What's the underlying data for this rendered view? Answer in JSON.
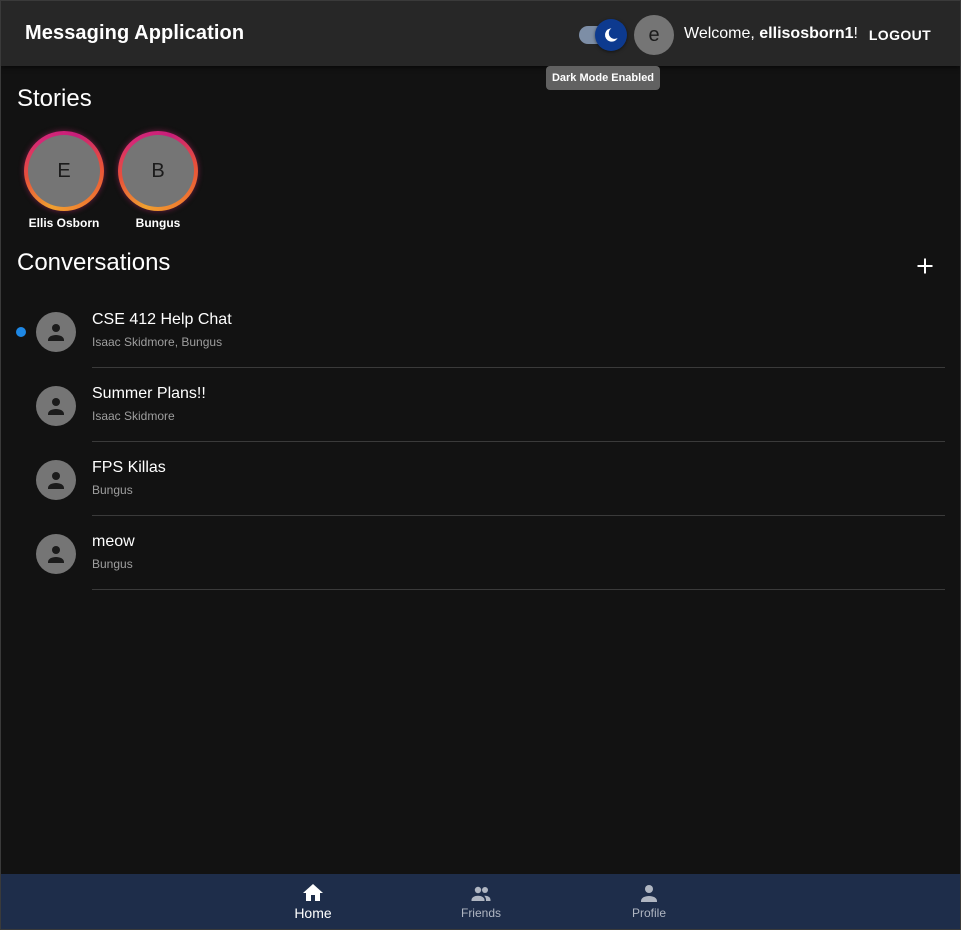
{
  "header": {
    "title": "Messaging Application",
    "avatar_initial": "e",
    "welcome_prefix": "Welcome, ",
    "username": "ellisosborn1",
    "welcome_suffix": "!",
    "logout_label": "LOGOUT",
    "dark_mode_tooltip": "Dark Mode Enabled",
    "dark_mode_enabled": true
  },
  "stories": {
    "heading": "Stories",
    "items": [
      {
        "initial": "E",
        "name": "Ellis Osborn"
      },
      {
        "initial": "B",
        "name": "Bungus"
      }
    ]
  },
  "conversations": {
    "heading": "Conversations",
    "add_icon": "plus-icon",
    "items": [
      {
        "title": "CSE 412 Help Chat",
        "members": "Isaac Skidmore, Bungus",
        "unread": true
      },
      {
        "title": "Summer Plans!!",
        "members": "Isaac Skidmore",
        "unread": false
      },
      {
        "title": "FPS Killas",
        "members": "Bungus",
        "unread": false
      },
      {
        "title": "meow",
        "members": "Bungus",
        "unread": false
      }
    ]
  },
  "bottom_nav": {
    "items": [
      {
        "label": "Home",
        "icon": "home-icon",
        "active": true
      },
      {
        "label": "Friends",
        "icon": "people-icon",
        "active": false
      },
      {
        "label": "Profile",
        "icon": "person-icon",
        "active": false
      }
    ]
  },
  "colors": {
    "background": "#121212",
    "appbar": "#272727",
    "bottom_nav": "#1e2d4a",
    "unread_dot": "#1e88e5",
    "switch_thumb": "#0d3a8f"
  }
}
